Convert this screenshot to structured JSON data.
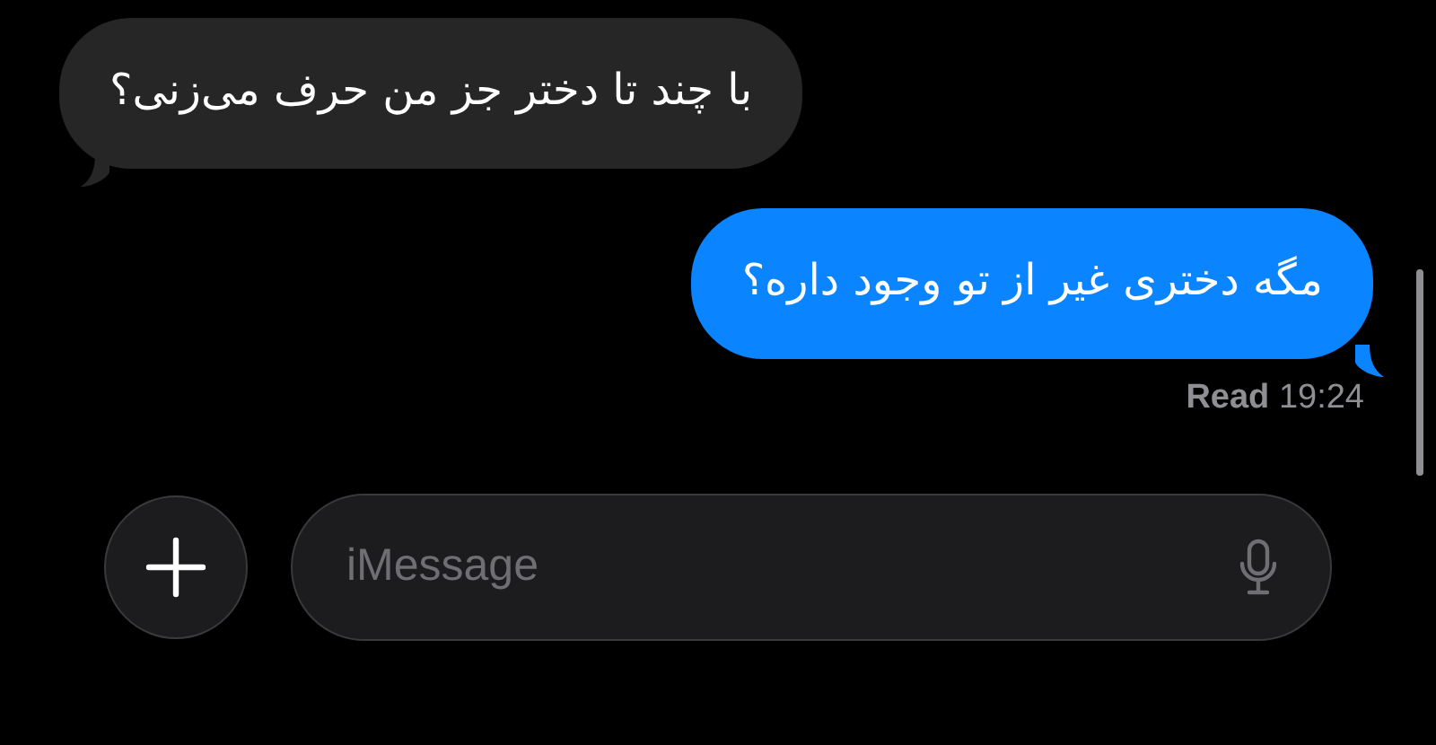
{
  "messages": [
    {
      "kind": "received",
      "text": "با چند تا دختر جز من حرف می‌زنی؟"
    },
    {
      "kind": "sent",
      "text": "مگه دختری غیر از تو وجود داره؟"
    }
  ],
  "read_receipt": "**Read** 19:24",
  "composer": {
    "placeholder": "iMessage"
  }
}
